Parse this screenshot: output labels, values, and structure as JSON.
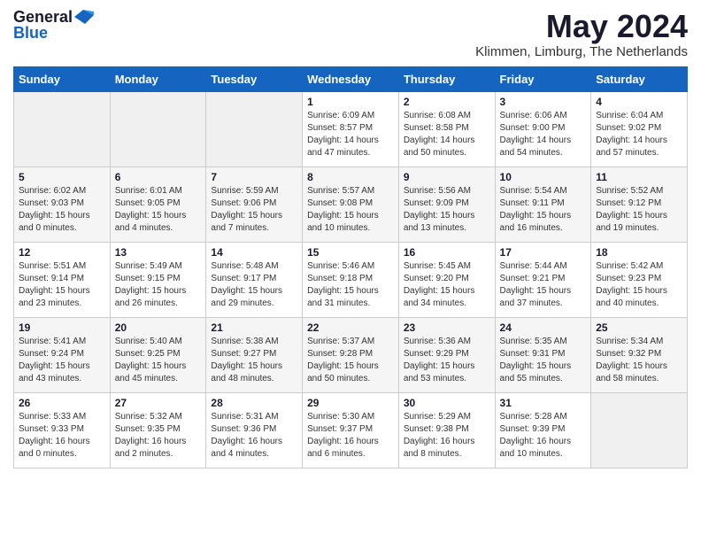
{
  "logo": {
    "general": "General",
    "blue": "Blue"
  },
  "calendar": {
    "title": "May 2024",
    "subtitle": "Klimmen, Limburg, The Netherlands"
  },
  "headers": [
    "Sunday",
    "Monday",
    "Tuesday",
    "Wednesday",
    "Thursday",
    "Friday",
    "Saturday"
  ],
  "weeks": [
    [
      {
        "day": "",
        "info": ""
      },
      {
        "day": "",
        "info": ""
      },
      {
        "day": "",
        "info": ""
      },
      {
        "day": "1",
        "info": "Sunrise: 6:09 AM\nSunset: 8:57 PM\nDaylight: 14 hours\nand 47 minutes."
      },
      {
        "day": "2",
        "info": "Sunrise: 6:08 AM\nSunset: 8:58 PM\nDaylight: 14 hours\nand 50 minutes."
      },
      {
        "day": "3",
        "info": "Sunrise: 6:06 AM\nSunset: 9:00 PM\nDaylight: 14 hours\nand 54 minutes."
      },
      {
        "day": "4",
        "info": "Sunrise: 6:04 AM\nSunset: 9:02 PM\nDaylight: 14 hours\nand 57 minutes."
      }
    ],
    [
      {
        "day": "5",
        "info": "Sunrise: 6:02 AM\nSunset: 9:03 PM\nDaylight: 15 hours\nand 0 minutes."
      },
      {
        "day": "6",
        "info": "Sunrise: 6:01 AM\nSunset: 9:05 PM\nDaylight: 15 hours\nand 4 minutes."
      },
      {
        "day": "7",
        "info": "Sunrise: 5:59 AM\nSunset: 9:06 PM\nDaylight: 15 hours\nand 7 minutes."
      },
      {
        "day": "8",
        "info": "Sunrise: 5:57 AM\nSunset: 9:08 PM\nDaylight: 15 hours\nand 10 minutes."
      },
      {
        "day": "9",
        "info": "Sunrise: 5:56 AM\nSunset: 9:09 PM\nDaylight: 15 hours\nand 13 minutes."
      },
      {
        "day": "10",
        "info": "Sunrise: 5:54 AM\nSunset: 9:11 PM\nDaylight: 15 hours\nand 16 minutes."
      },
      {
        "day": "11",
        "info": "Sunrise: 5:52 AM\nSunset: 9:12 PM\nDaylight: 15 hours\nand 19 minutes."
      }
    ],
    [
      {
        "day": "12",
        "info": "Sunrise: 5:51 AM\nSunset: 9:14 PM\nDaylight: 15 hours\nand 23 minutes."
      },
      {
        "day": "13",
        "info": "Sunrise: 5:49 AM\nSunset: 9:15 PM\nDaylight: 15 hours\nand 26 minutes."
      },
      {
        "day": "14",
        "info": "Sunrise: 5:48 AM\nSunset: 9:17 PM\nDaylight: 15 hours\nand 29 minutes."
      },
      {
        "day": "15",
        "info": "Sunrise: 5:46 AM\nSunset: 9:18 PM\nDaylight: 15 hours\nand 31 minutes."
      },
      {
        "day": "16",
        "info": "Sunrise: 5:45 AM\nSunset: 9:20 PM\nDaylight: 15 hours\nand 34 minutes."
      },
      {
        "day": "17",
        "info": "Sunrise: 5:44 AM\nSunset: 9:21 PM\nDaylight: 15 hours\nand 37 minutes."
      },
      {
        "day": "18",
        "info": "Sunrise: 5:42 AM\nSunset: 9:23 PM\nDaylight: 15 hours\nand 40 minutes."
      }
    ],
    [
      {
        "day": "19",
        "info": "Sunrise: 5:41 AM\nSunset: 9:24 PM\nDaylight: 15 hours\nand 43 minutes."
      },
      {
        "day": "20",
        "info": "Sunrise: 5:40 AM\nSunset: 9:25 PM\nDaylight: 15 hours\nand 45 minutes."
      },
      {
        "day": "21",
        "info": "Sunrise: 5:38 AM\nSunset: 9:27 PM\nDaylight: 15 hours\nand 48 minutes."
      },
      {
        "day": "22",
        "info": "Sunrise: 5:37 AM\nSunset: 9:28 PM\nDaylight: 15 hours\nand 50 minutes."
      },
      {
        "day": "23",
        "info": "Sunrise: 5:36 AM\nSunset: 9:29 PM\nDaylight: 15 hours\nand 53 minutes."
      },
      {
        "day": "24",
        "info": "Sunrise: 5:35 AM\nSunset: 9:31 PM\nDaylight: 15 hours\nand 55 minutes."
      },
      {
        "day": "25",
        "info": "Sunrise: 5:34 AM\nSunset: 9:32 PM\nDaylight: 15 hours\nand 58 minutes."
      }
    ],
    [
      {
        "day": "26",
        "info": "Sunrise: 5:33 AM\nSunset: 9:33 PM\nDaylight: 16 hours\nand 0 minutes."
      },
      {
        "day": "27",
        "info": "Sunrise: 5:32 AM\nSunset: 9:35 PM\nDaylight: 16 hours\nand 2 minutes."
      },
      {
        "day": "28",
        "info": "Sunrise: 5:31 AM\nSunset: 9:36 PM\nDaylight: 16 hours\nand 4 minutes."
      },
      {
        "day": "29",
        "info": "Sunrise: 5:30 AM\nSunset: 9:37 PM\nDaylight: 16 hours\nand 6 minutes."
      },
      {
        "day": "30",
        "info": "Sunrise: 5:29 AM\nSunset: 9:38 PM\nDaylight: 16 hours\nand 8 minutes."
      },
      {
        "day": "31",
        "info": "Sunrise: 5:28 AM\nSunset: 9:39 PM\nDaylight: 16 hours\nand 10 minutes."
      },
      {
        "day": "",
        "info": ""
      }
    ]
  ]
}
